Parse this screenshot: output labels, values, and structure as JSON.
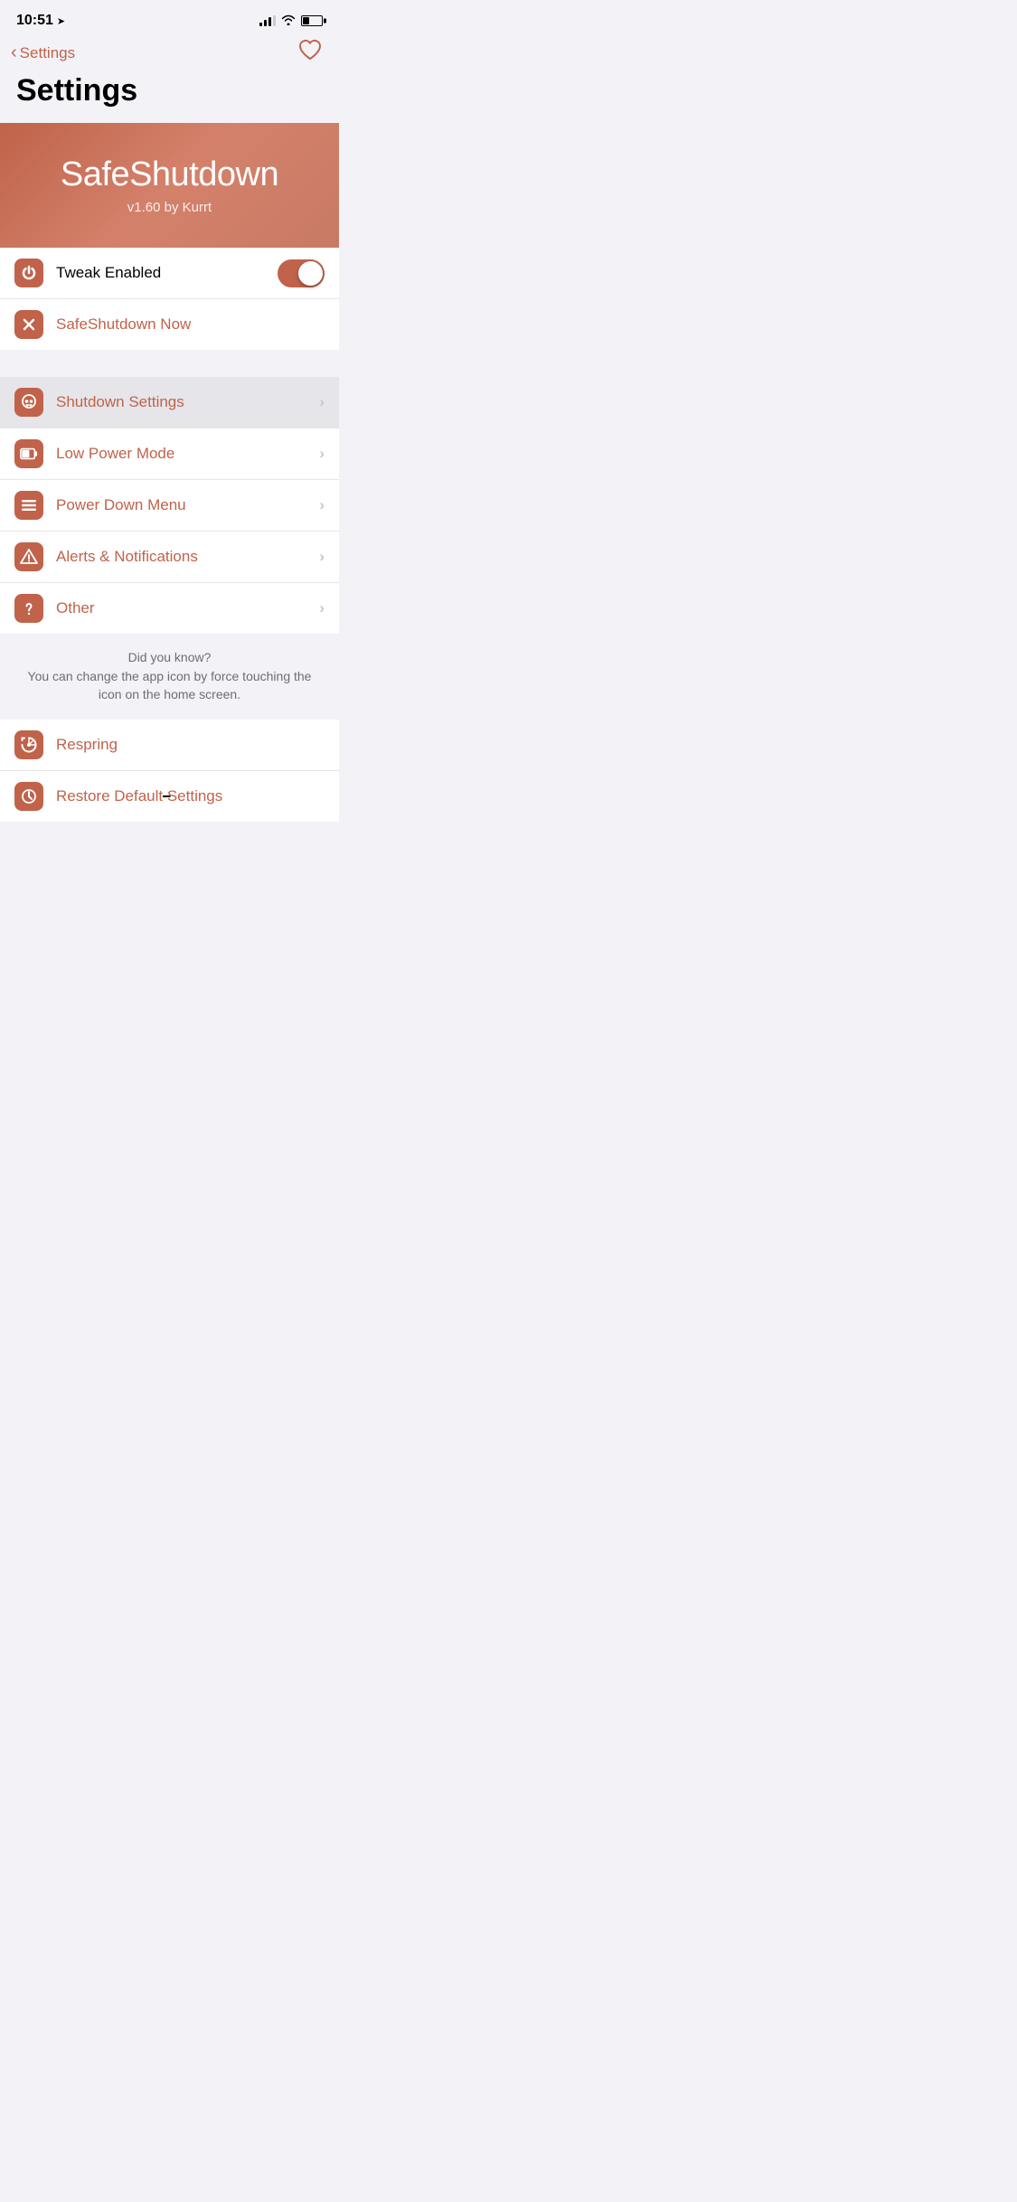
{
  "statusBar": {
    "time": "10:51",
    "locationIcon": "➤"
  },
  "nav": {
    "backLabel": "Settings",
    "heartIcon": "♡"
  },
  "pageTitle": "Settings",
  "hero": {
    "title": "SafeShutdown",
    "subtitle": "v1.60 by Kurrt"
  },
  "section1": {
    "rows": [
      {
        "id": "tweak-enabled",
        "label": "Tweak Enabled",
        "type": "toggle",
        "toggleOn": true,
        "icon": "power"
      },
      {
        "id": "safeshutdown-now",
        "label": "SafeShutdown Now",
        "type": "action",
        "icon": "x",
        "orange": true
      }
    ]
  },
  "section2": {
    "rows": [
      {
        "id": "shutdown-settings",
        "label": "Shutdown Settings",
        "type": "nav",
        "icon": "skull",
        "orange": true,
        "highlighted": true
      },
      {
        "id": "low-power-mode",
        "label": "Low Power Mode",
        "type": "nav",
        "icon": "battery",
        "orange": true
      },
      {
        "id": "power-down-menu",
        "label": "Power Down Menu",
        "type": "nav",
        "icon": "menu",
        "orange": true
      },
      {
        "id": "alerts-notifications",
        "label": "Alerts & Notifications",
        "type": "nav",
        "icon": "alert",
        "orange": true
      },
      {
        "id": "other",
        "label": "Other",
        "type": "nav",
        "icon": "question",
        "orange": true
      }
    ]
  },
  "footerTip": {
    "title": "Did you know?",
    "body": "You can change the app icon by force touching the icon on the home screen."
  },
  "section3": {
    "rows": [
      {
        "id": "respring",
        "label": "Respring",
        "type": "action",
        "icon": "respring",
        "orange": true
      },
      {
        "id": "restore-defaults",
        "label": "Restore Default Settings",
        "type": "action",
        "icon": "restore",
        "orange": true
      }
    ]
  },
  "chevron": "›",
  "colors": {
    "accent": "#c0634a",
    "background": "#f2f2f7"
  }
}
